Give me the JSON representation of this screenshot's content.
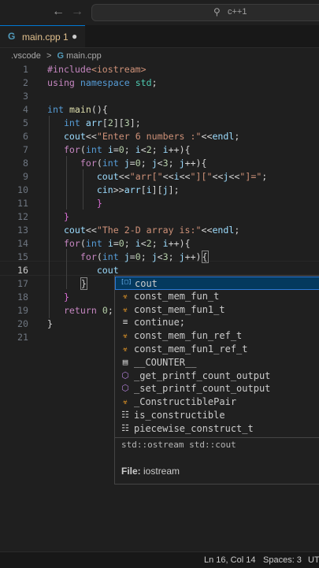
{
  "titlebar": {
    "back_icon": "arrow-left-icon",
    "forward_icon": "arrow-right-icon",
    "search_text": "c++1"
  },
  "tab": {
    "label": "main.cpp",
    "badge": "1"
  },
  "breadcrumb": {
    "folder": ".vscode",
    "separator": ">",
    "file": "main.cpp"
  },
  "editor": {
    "line_numbers": [
      "1",
      "2",
      "3",
      "4",
      "5",
      "6",
      "7",
      "8",
      "9",
      "10",
      "11",
      "12",
      "13",
      "14",
      "15",
      "16",
      "17",
      "18",
      "19",
      "20",
      "21"
    ]
  },
  "suggest": {
    "items": [
      {
        "icon": "symbol-variable-icon",
        "label": "cout"
      },
      {
        "icon": "symbol-class-icon",
        "label": "const_mem_fun_t"
      },
      {
        "icon": "symbol-class-icon",
        "label": "const_mem_fun1_t"
      },
      {
        "icon": "keyword-icon",
        "label": "continue;"
      },
      {
        "icon": "symbol-class-icon",
        "label": "const_mem_fun_ref_t"
      },
      {
        "icon": "symbol-class-icon",
        "label": "const_mem_fun1_ref_t"
      },
      {
        "icon": "symbol-constant-icon",
        "label": "__COUNTER__"
      },
      {
        "icon": "symbol-method-icon",
        "label": "_get_printf_count_output"
      },
      {
        "icon": "symbol-method-icon",
        "label": "_set_printf_count_output"
      },
      {
        "icon": "symbol-class-icon",
        "label": "_ConstructiblePair"
      },
      {
        "icon": "symbol-struct-icon",
        "label": "is_constructible"
      },
      {
        "icon": "symbol-struct-icon",
        "label": "piecewise_construct_t"
      }
    ],
    "detail": "std::ostream std::cout",
    "file_label": "File:",
    "file_value": "iostream"
  },
  "status": {
    "position": "Ln 16, Col 14",
    "spaces": "Spaces: 3",
    "encoding": "UT"
  }
}
